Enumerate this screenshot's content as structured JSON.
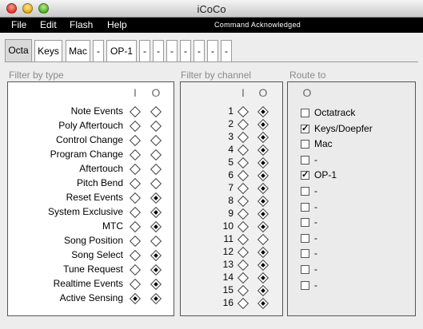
{
  "window": {
    "title": "iCoCo"
  },
  "menubar": {
    "items": [
      "File",
      "Edit",
      "Flash",
      "Help"
    ],
    "status": "Command Acknowledged"
  },
  "tabs": [
    "Octa",
    "Keys",
    "Mac",
    "-",
    "OP-1",
    "-",
    "-",
    "-",
    "-",
    "-",
    "-",
    "-"
  ],
  "active_tab": "Octa",
  "filter_type": {
    "label": "Filter by type",
    "col_in": "I",
    "col_out": "O",
    "rows": [
      {
        "label": "Note Events",
        "in": false,
        "out": false
      },
      {
        "label": "Poly Aftertouch",
        "in": false,
        "out": false
      },
      {
        "label": "Control Change",
        "in": false,
        "out": false
      },
      {
        "label": "Program Change",
        "in": false,
        "out": false
      },
      {
        "label": "Aftertouch",
        "in": false,
        "out": false
      },
      {
        "label": "Pitch Bend",
        "in": false,
        "out": false
      },
      {
        "label": "Reset Events",
        "in": false,
        "out": true
      },
      {
        "label": "System Exclusive",
        "in": false,
        "out": true
      },
      {
        "label": "MTC",
        "in": false,
        "out": true
      },
      {
        "label": "Song Position",
        "in": false,
        "out": false
      },
      {
        "label": "Song Select",
        "in": false,
        "out": true
      },
      {
        "label": "Tune Request",
        "in": false,
        "out": true
      },
      {
        "label": "Realtime Events",
        "in": false,
        "out": true
      },
      {
        "label": "Active Sensing",
        "in": true,
        "out": true
      }
    ]
  },
  "filter_channel": {
    "label": "Filter by channel",
    "col_in": "I",
    "col_out": "O",
    "rows": [
      {
        "label": "1",
        "in": false,
        "out": true
      },
      {
        "label": "2",
        "in": false,
        "out": true
      },
      {
        "label": "3",
        "in": false,
        "out": true
      },
      {
        "label": "4",
        "in": false,
        "out": true
      },
      {
        "label": "5",
        "in": false,
        "out": true
      },
      {
        "label": "6",
        "in": false,
        "out": true
      },
      {
        "label": "7",
        "in": false,
        "out": true
      },
      {
        "label": "8",
        "in": false,
        "out": true
      },
      {
        "label": "9",
        "in": false,
        "out": true
      },
      {
        "label": "10",
        "in": false,
        "out": true
      },
      {
        "label": "11",
        "in": false,
        "out": false
      },
      {
        "label": "12",
        "in": false,
        "out": true
      },
      {
        "label": "13",
        "in": false,
        "out": true
      },
      {
        "label": "14",
        "in": false,
        "out": true
      },
      {
        "label": "15",
        "in": false,
        "out": true
      },
      {
        "label": "16",
        "in": false,
        "out": true
      }
    ]
  },
  "route": {
    "label": "Route to",
    "col_out": "O",
    "items": [
      {
        "label": "Octatrack",
        "checked": false
      },
      {
        "label": "Keys/Doepfer",
        "checked": true
      },
      {
        "label": "Mac",
        "checked": false
      },
      {
        "label": "-",
        "checked": false
      },
      {
        "label": "OP-1",
        "checked": true
      },
      {
        "label": "-",
        "checked": false
      },
      {
        "label": "-",
        "checked": false
      },
      {
        "label": "-",
        "checked": false
      },
      {
        "label": "-",
        "checked": false
      },
      {
        "label": "-",
        "checked": false
      },
      {
        "label": "-",
        "checked": false
      },
      {
        "label": "-",
        "checked": false
      }
    ]
  }
}
